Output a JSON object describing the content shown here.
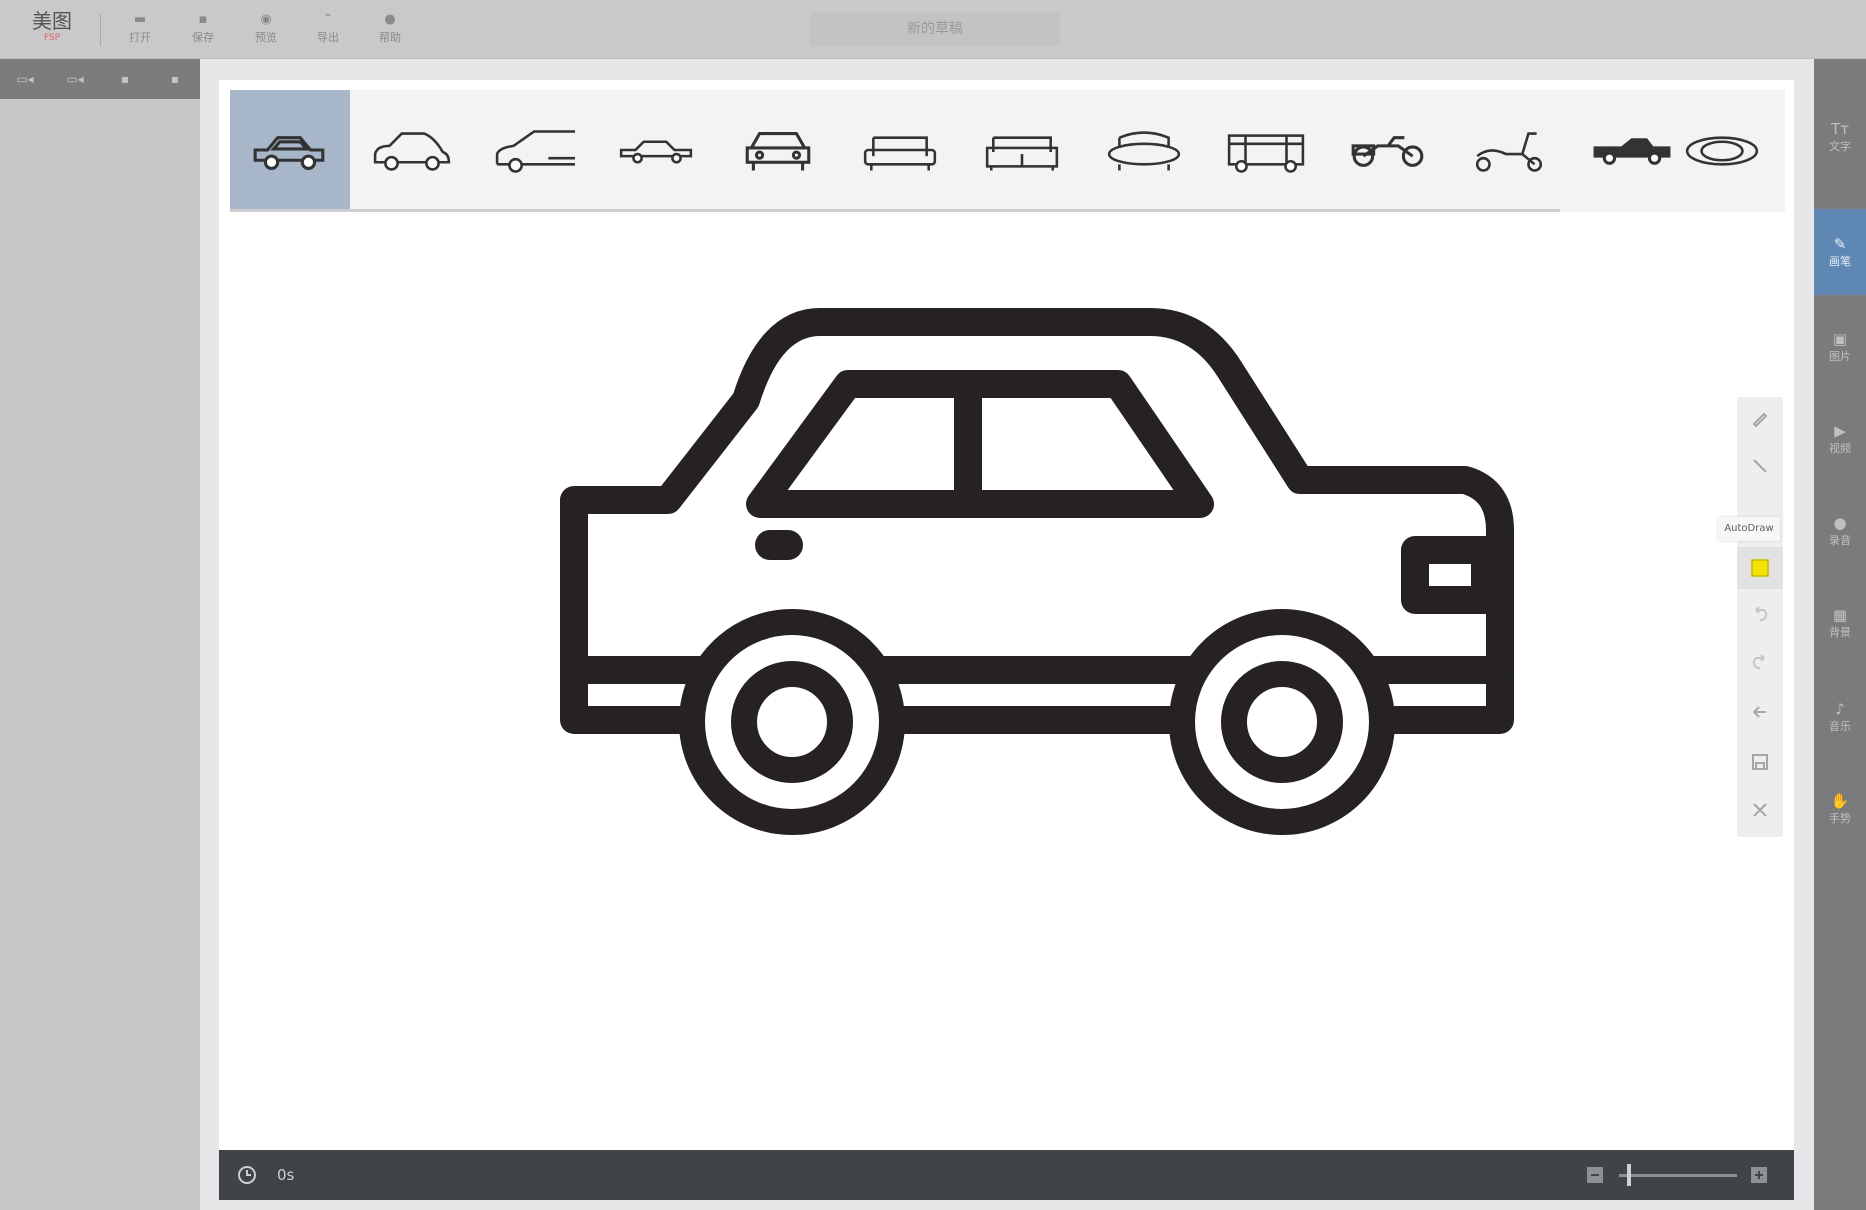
{
  "app": {
    "logo_main": "美图",
    "logo_sub": "FSP",
    "document_title": "新的草稿"
  },
  "toolbar": {
    "open": {
      "icon": "folder-icon",
      "label": "打开"
    },
    "save": {
      "icon": "save-icon",
      "label": "保存"
    },
    "preview": {
      "icon": "eye-icon",
      "label": "预览"
    },
    "export": {
      "icon": "export-icon",
      "label": "导出"
    },
    "help": {
      "icon": "help-icon",
      "label": "帮助"
    }
  },
  "left_panel": {
    "tools": [
      "add-scene-icon",
      "copy-scene-icon",
      "move-up-icon",
      "delete-icon"
    ]
  },
  "suggestions": {
    "selected_index": 0,
    "items": [
      "car",
      "car-outline",
      "car-partial",
      "sedan-small",
      "car-front",
      "armchair",
      "sofa",
      "loveseat",
      "fire-truck",
      "motorcycle",
      "scooter",
      "pickup-truck",
      "planet"
    ]
  },
  "mini_toolbar": {
    "tooltip": "AutoDraw",
    "tools": [
      "pencil-icon",
      "brush-icon",
      "autodraw-icon",
      "undo-icon",
      "redo-icon",
      "back-arrow-icon",
      "save-icon",
      "close-icon"
    ],
    "selected": "autodraw-icon",
    "accent_color": "#f4e200"
  },
  "status_bar": {
    "timer": "0s"
  },
  "right_panel": {
    "text": {
      "icon": "Tт",
      "label": "文字"
    },
    "brush": {
      "icon": "✎",
      "label": "画笔"
    },
    "image": {
      "icon": "▣",
      "label": "图片"
    },
    "video": {
      "icon": "▶",
      "label": "视频"
    },
    "record": {
      "icon": "●",
      "label": "录音"
    },
    "background": {
      "icon": "▦",
      "label": "背景"
    },
    "music": {
      "icon": "♪",
      "label": "音乐"
    },
    "hand": {
      "icon": "✋",
      "label": "手势"
    },
    "active": "brush"
  }
}
